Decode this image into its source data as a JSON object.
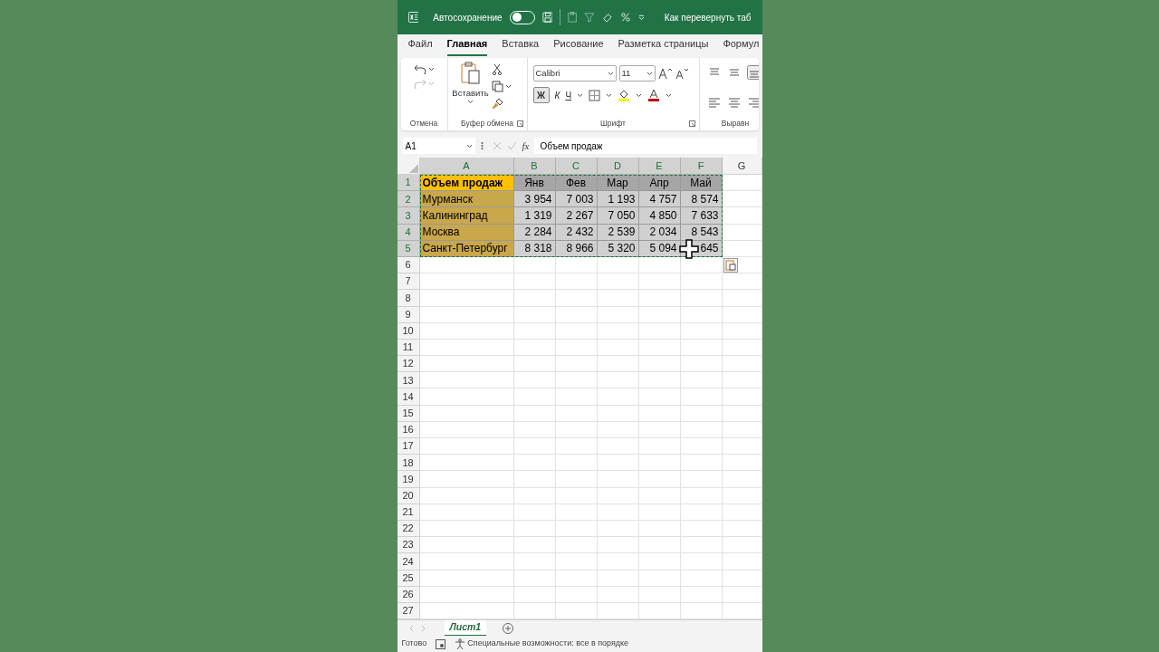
{
  "title_bar": {
    "autosave_label": "Автосохранение",
    "autosave_on": false,
    "document_title": "Как перевернуть таб"
  },
  "menu_tabs": [
    {
      "label": "Файл",
      "selected": false
    },
    {
      "label": "Главная",
      "selected": true
    },
    {
      "label": "Вставка",
      "selected": false
    },
    {
      "label": "Рисование",
      "selected": false
    },
    {
      "label": "Разметка страницы",
      "selected": false
    },
    {
      "label": "Формул",
      "selected": false
    }
  ],
  "ribbon": {
    "undo_group": "Отмена",
    "paste_label": "Вставить",
    "clipboard_group": "Буфер обмена",
    "font_name": "Calibri",
    "font_size": "11",
    "bold": "Ж",
    "italic": "К",
    "underline": "Ч",
    "bold_on": true,
    "font_group": "Шрифт",
    "align_group": "Выравн"
  },
  "formula_bar": {
    "cell_ref": "A1",
    "fx": "fx",
    "value": "Объем продаж"
  },
  "columns": [
    {
      "label": "A",
      "selected": true
    },
    {
      "label": "B",
      "selected": true
    },
    {
      "label": "C",
      "selected": true
    },
    {
      "label": "D",
      "selected": true
    },
    {
      "label": "E",
      "selected": true
    },
    {
      "label": "F",
      "selected": true
    },
    {
      "label": "G",
      "selected": false
    }
  ],
  "rows": [
    {
      "number": "1",
      "selected": true,
      "cells": [
        {
          "kind": "title",
          "text": "Объем продаж"
        },
        {
          "kind": "header",
          "text": "Янв"
        },
        {
          "kind": "header",
          "text": "Фев"
        },
        {
          "kind": "header",
          "text": "Мар"
        },
        {
          "kind": "header",
          "text": "Апр"
        },
        {
          "kind": "header",
          "text": "Май"
        }
      ]
    },
    {
      "number": "2",
      "selected": true,
      "cells": [
        {
          "kind": "label",
          "text": "Мурманск"
        },
        {
          "kind": "value",
          "text": "3 954"
        },
        {
          "kind": "value",
          "text": "7 003"
        },
        {
          "kind": "value",
          "text": "1 193"
        },
        {
          "kind": "value",
          "text": "4 757"
        },
        {
          "kind": "value",
          "text": "8 574"
        }
      ]
    },
    {
      "number": "3",
      "selected": true,
      "cells": [
        {
          "kind": "label",
          "text": "Калининград"
        },
        {
          "kind": "value",
          "text": "1 319"
        },
        {
          "kind": "value",
          "text": "2 267"
        },
        {
          "kind": "value",
          "text": "7 050"
        },
        {
          "kind": "value",
          "text": "4 850"
        },
        {
          "kind": "value",
          "text": "7 633"
        }
      ]
    },
    {
      "number": "4",
      "selected": true,
      "cells": [
        {
          "kind": "label",
          "text": "Москва"
        },
        {
          "kind": "value",
          "text": "2 284"
        },
        {
          "kind": "value",
          "text": "2 432"
        },
        {
          "kind": "value",
          "text": "2 539"
        },
        {
          "kind": "value",
          "text": "2 034"
        },
        {
          "kind": "value",
          "text": "8 543"
        }
      ]
    },
    {
      "number": "5",
      "selected": true,
      "cells": [
        {
          "kind": "label",
          "text": "Санкт-Петербург"
        },
        {
          "kind": "value",
          "text": "8 318"
        },
        {
          "kind": "value",
          "text": "8 966"
        },
        {
          "kind": "value",
          "text": "5 320"
        },
        {
          "kind": "value",
          "text": "5 094"
        },
        {
          "kind": "value",
          "text": "645"
        }
      ]
    },
    {
      "number": "6",
      "selected": false,
      "cells": []
    },
    {
      "number": "7",
      "selected": false,
      "cells": []
    },
    {
      "number": "8",
      "selected": false,
      "cells": []
    },
    {
      "number": "9",
      "selected": false,
      "cells": []
    },
    {
      "number": "10",
      "selected": false,
      "cells": []
    },
    {
      "number": "11",
      "selected": false,
      "cells": []
    },
    {
      "number": "12",
      "selected": false,
      "cells": []
    },
    {
      "number": "13",
      "selected": false,
      "cells": []
    },
    {
      "number": "14",
      "selected": false,
      "cells": []
    },
    {
      "number": "15",
      "selected": false,
      "cells": []
    },
    {
      "number": "16",
      "selected": false,
      "cells": []
    },
    {
      "number": "17",
      "selected": false,
      "cells": []
    },
    {
      "number": "18",
      "selected": false,
      "cells": []
    },
    {
      "number": "19",
      "selected": false,
      "cells": []
    },
    {
      "number": "20",
      "selected": false,
      "cells": []
    },
    {
      "number": "21",
      "selected": false,
      "cells": []
    },
    {
      "number": "22",
      "selected": false,
      "cells": []
    },
    {
      "number": "23",
      "selected": false,
      "cells": []
    },
    {
      "number": "24",
      "selected": false,
      "cells": []
    },
    {
      "number": "25",
      "selected": false,
      "cells": []
    },
    {
      "number": "26",
      "selected": false,
      "cells": []
    },
    {
      "number": "27",
      "selected": false,
      "cells": []
    }
  ],
  "sheet_tabs": [
    {
      "label": "Лист1",
      "selected": true
    }
  ],
  "status_bar": {
    "state": "Готово",
    "accessibility": "Специальные возможности: все в порядке"
  }
}
